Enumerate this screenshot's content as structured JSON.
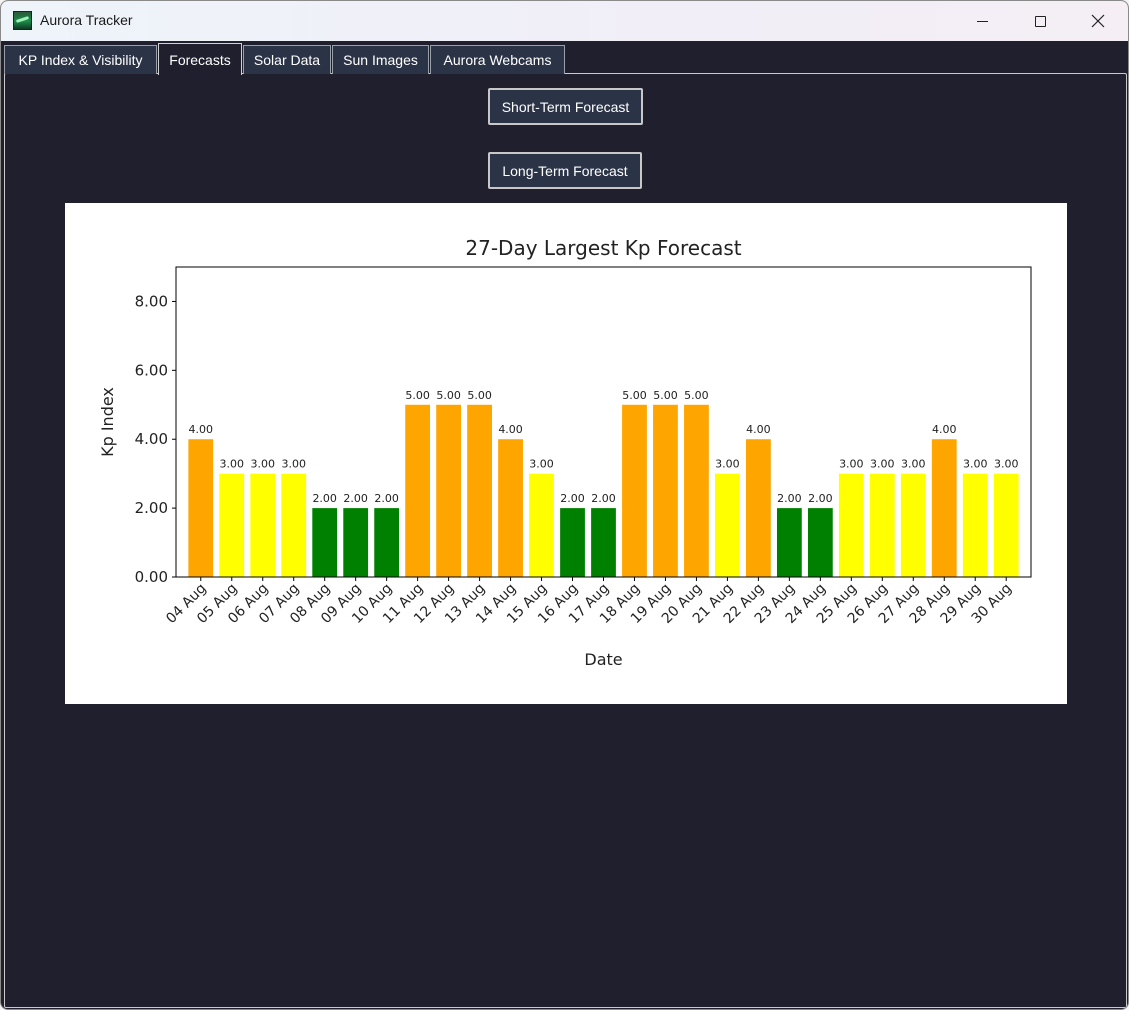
{
  "window": {
    "title": "Aurora Tracker"
  },
  "tabs": [
    {
      "label": "KP Index & Visibility",
      "active": false
    },
    {
      "label": "Forecasts",
      "active": true
    },
    {
      "label": "Solar Data",
      "active": false
    },
    {
      "label": "Sun Images",
      "active": false
    },
    {
      "label": "Aurora Webcams",
      "active": false
    }
  ],
  "buttons": {
    "short_term": "Short-Term Forecast",
    "long_term": "Long-Term Forecast"
  },
  "colors": {
    "window_bg": "#1f1f2e",
    "button_bg": "#2b3346",
    "kp_low": "#008000",
    "kp_mid": "#ffff00",
    "kp_high": "#ffa500"
  },
  "chart_data": {
    "type": "bar",
    "title": "27-Day Largest Kp Forecast",
    "xlabel": "Date",
    "ylabel": "Kp Index",
    "ylim": [
      0,
      9
    ],
    "yticks": [
      "0.00",
      "2.00",
      "4.00",
      "6.00",
      "8.00"
    ],
    "grid": false,
    "categories": [
      "04 Aug",
      "05 Aug",
      "06 Aug",
      "07 Aug",
      "08 Aug",
      "09 Aug",
      "10 Aug",
      "11 Aug",
      "12 Aug",
      "13 Aug",
      "14 Aug",
      "15 Aug",
      "16 Aug",
      "17 Aug",
      "18 Aug",
      "19 Aug",
      "20 Aug",
      "21 Aug",
      "22 Aug",
      "23 Aug",
      "24 Aug",
      "25 Aug",
      "26 Aug",
      "27 Aug",
      "28 Aug",
      "29 Aug",
      "30 Aug"
    ],
    "values": [
      4,
      3,
      3,
      3,
      2,
      2,
      2,
      5,
      5,
      5,
      4,
      3,
      2,
      2,
      5,
      5,
      5,
      3,
      4,
      2,
      2,
      3,
      3,
      3,
      4,
      3,
      3
    ],
    "data_labels": [
      "4.00",
      "3.00",
      "3.00",
      "3.00",
      "2.00",
      "2.00",
      "2.00",
      "5.00",
      "5.00",
      "5.00",
      "4.00",
      "3.00",
      "2.00",
      "2.00",
      "5.00",
      "5.00",
      "5.00",
      "3.00",
      "4.00",
      "2.00",
      "2.00",
      "3.00",
      "3.00",
      "3.00",
      "4.00",
      "3.00",
      "3.00"
    ],
    "bar_colors": [
      "#ffa500",
      "#ffff00",
      "#ffff00",
      "#ffff00",
      "#008000",
      "#008000",
      "#008000",
      "#ffa500",
      "#ffa500",
      "#ffa500",
      "#ffa500",
      "#ffff00",
      "#008000",
      "#008000",
      "#ffa500",
      "#ffa500",
      "#ffa500",
      "#ffff00",
      "#ffa500",
      "#008000",
      "#008000",
      "#ffff00",
      "#ffff00",
      "#ffff00",
      "#ffa500",
      "#ffff00",
      "#ffff00"
    ]
  }
}
